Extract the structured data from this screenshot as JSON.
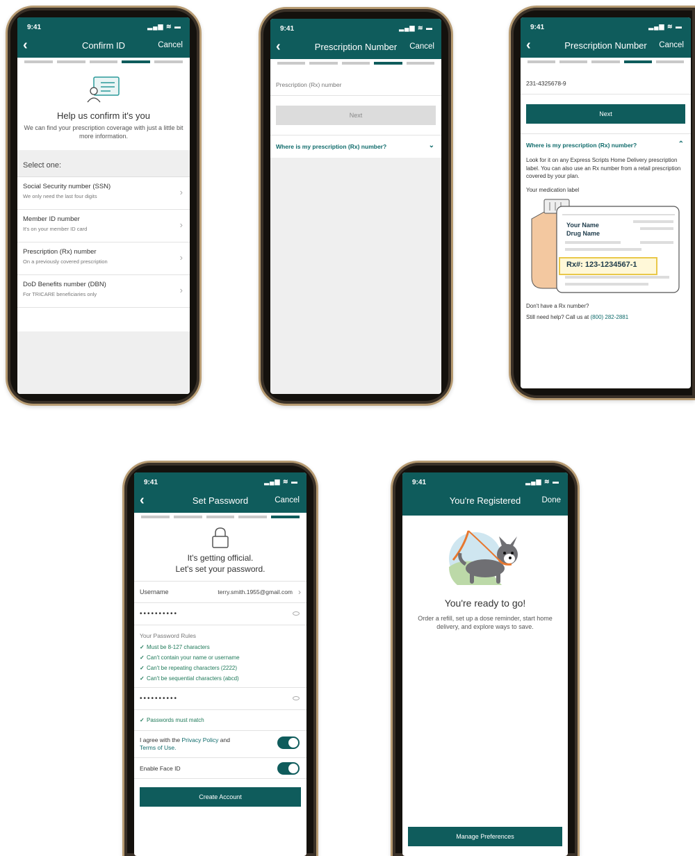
{
  "status": {
    "time": "9:41",
    "indicators": "▂▄▆ ≋ ▬"
  },
  "confirm_id": {
    "nav_title": "Confirm ID",
    "cancel": "Cancel",
    "heading": "Help us confirm it's you",
    "subtitle": "We can find your prescription coverage with just a little bit more information.",
    "select_label": "Select one:",
    "options": [
      {
        "title": "Social Security number (SSN)",
        "subtitle": "We only need the last four digits"
      },
      {
        "title": "Member ID number",
        "subtitle": "It's on your member ID card"
      },
      {
        "title": "Prescription (Rx) number",
        "subtitle": "On a previously covered prescription"
      },
      {
        "title": "DoD Benefits number (DBN)",
        "subtitle": "For TRICARE beneficiaries only"
      }
    ]
  },
  "rx_empty": {
    "nav_title": "Prescription Number",
    "cancel": "Cancel",
    "placeholder": "Prescription (Rx) number",
    "next": "Next",
    "expander": "Where is my prescription (Rx) number?"
  },
  "rx_filled": {
    "nav_title": "Prescription Number",
    "cancel": "Cancel",
    "value": "231-4325678-9",
    "next": "Next",
    "expander": "Where is my prescription (Rx) number?",
    "help": "Look for it on any Express Scripts Home Delivery prescription label. You can also use an Rx number from a retail prescription covered by your plan.",
    "label_heading": "Your medication label",
    "label_name": "Your Name",
    "label_drug": "Drug Name",
    "label_rx": "Rx#: 123-1234567-1",
    "no_rx": "Don't have a Rx number?",
    "call_prefix": "Still need help? Call us at ",
    "phone": "(800) 282-2881"
  },
  "set_password": {
    "nav_title": "Set Password",
    "cancel": "Cancel",
    "heading_1": "It's getting official.",
    "heading_2": "Let's set your password.",
    "username_label": "Username",
    "username_value": "terry.smith.1955@gmail.com",
    "password_mask": "••••••••••",
    "rules_title": "Your Password Rules",
    "rules": [
      "Must be 8-127 characters",
      "Can't contain your name or username",
      "Can't be repeating characters (2222)",
      "Can't be sequential characters (abcd)"
    ],
    "confirm_mask": "••••••••••",
    "match_rule": "Passwords must match",
    "agree_prefix": "I agree with the ",
    "privacy_link": "Privacy Policy",
    "agree_mid": " and",
    "terms_link": "Terms of Use.",
    "face_id": "Enable Face ID",
    "create": "Create Account"
  },
  "registered": {
    "nav_title": "You're Registered",
    "done": "Done",
    "heading": "You're ready to go!",
    "body": "Order a refill, set up a dose reminder, start home delivery, and explore ways to save.",
    "manage": "Manage Preferences"
  }
}
